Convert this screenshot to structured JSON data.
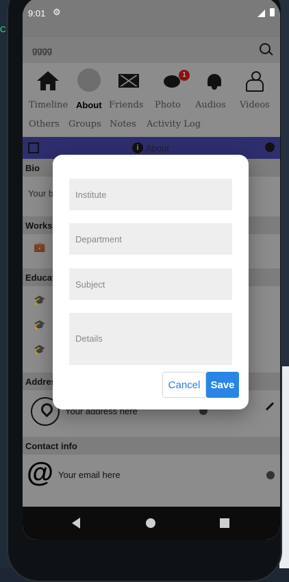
{
  "desktop": {
    "edge_text": "C"
  },
  "status_bar": {
    "time": "9:01"
  },
  "search": {
    "value": "gggg"
  },
  "nav_tabs_row1": [
    "Timeline",
    "About",
    "Friends",
    "Photo",
    "Audios",
    "Videos"
  ],
  "nav_tabs_row2": [
    "Others",
    "Groups",
    "Notes",
    "Activity Log"
  ],
  "chat_badge": "1",
  "about_bar": {
    "title": "About"
  },
  "sections": {
    "bio": "Bio",
    "bio_placeholder": "Your b",
    "works": "Works",
    "education": "Educat",
    "address": "Addres",
    "address_value": "Your address here",
    "contact": "Contact info",
    "email_value": "Your email here"
  },
  "dialog": {
    "institute_placeholder": "Institute",
    "department_placeholder": "Department",
    "subject_placeholder": "Subject",
    "details_placeholder": "Details",
    "cancel_label": "Cancel",
    "save_label": "Save"
  },
  "colors": {
    "accent": "#2a86e5",
    "about_bar": "#2e2e6f",
    "badge": "#8b1010"
  }
}
